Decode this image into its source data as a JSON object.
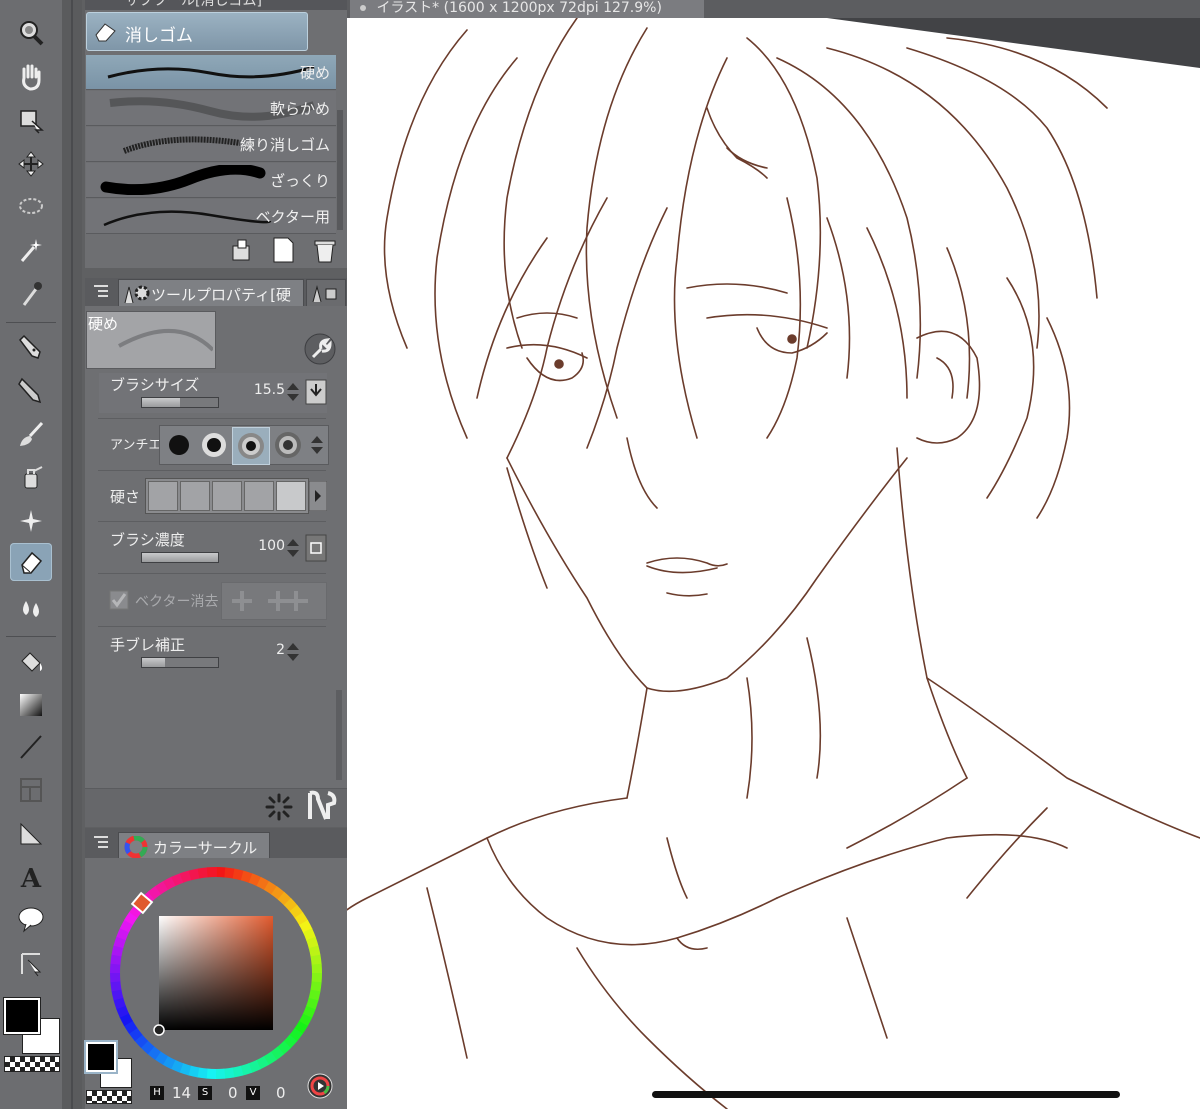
{
  "document": {
    "title": "イラスト* (1600 x 1200px 72dpi 127.9%)"
  },
  "subtool_panel": {
    "header_title": "サブツール[消しゴム]",
    "group_label": "消しゴム",
    "brushes": [
      {
        "label": "硬め",
        "selected": true
      },
      {
        "label": "軟らかめ",
        "selected": false
      },
      {
        "label": "練り消しゴム",
        "selected": false
      },
      {
        "label": "ざっくり",
        "selected": false
      },
      {
        "label": "ベクター用",
        "selected": false
      }
    ]
  },
  "tool_property": {
    "tab_label": "ツールプロパティ[硬",
    "preset_name": "硬め",
    "brush_size": {
      "label": "ブラシサイズ",
      "value": "15.5",
      "level": 0.3
    },
    "anti_alias": {
      "label": "アンチエ",
      "selected_index": 2
    },
    "hardness": {
      "label": "硬さ",
      "selected_index": 4
    },
    "brush_density": {
      "label": "ブラシ濃度",
      "value": "100",
      "level": 1.0
    },
    "vector_erase": {
      "label": "ベクター消去",
      "checked": true
    },
    "stabilization": {
      "label": "手ブレ補正",
      "value": "2",
      "level": 0.2
    }
  },
  "color_panel": {
    "tab_label": "カラーサークル",
    "hue_color": "#e05a2e",
    "main_color": "#000000",
    "sub_color": "#ffffff",
    "hsv": {
      "h_label": "H",
      "h_value": "14",
      "s_label": "S",
      "s_value": "0",
      "v_label": "V",
      "v_value": "0"
    }
  },
  "toolbar": {
    "tools": [
      "zoom-icon",
      "hand-icon",
      "object-icon",
      "move-layer-icon",
      "lasso-select-icon",
      "magic-wand-icon",
      "eyedropper-icon",
      "pen-icon",
      "pencil-icon",
      "brush-icon",
      "airbrush-icon",
      "decoration-icon",
      "eraser-icon",
      "blend-icon",
      "fill-icon",
      "gradient-icon",
      "line-icon",
      "frame-icon",
      "ruler-icon",
      "text-icon",
      "balloon-icon",
      "correct-line-icon"
    ],
    "active_tool": "eraser-icon",
    "main_color": "#000000",
    "sub_color": "#ffffff"
  },
  "colors": {
    "panel_bg": "#6e6f72",
    "accent_selected": "#8aa3b6",
    "line_art": "#6b3c2c",
    "canvas": "#ffffff"
  }
}
